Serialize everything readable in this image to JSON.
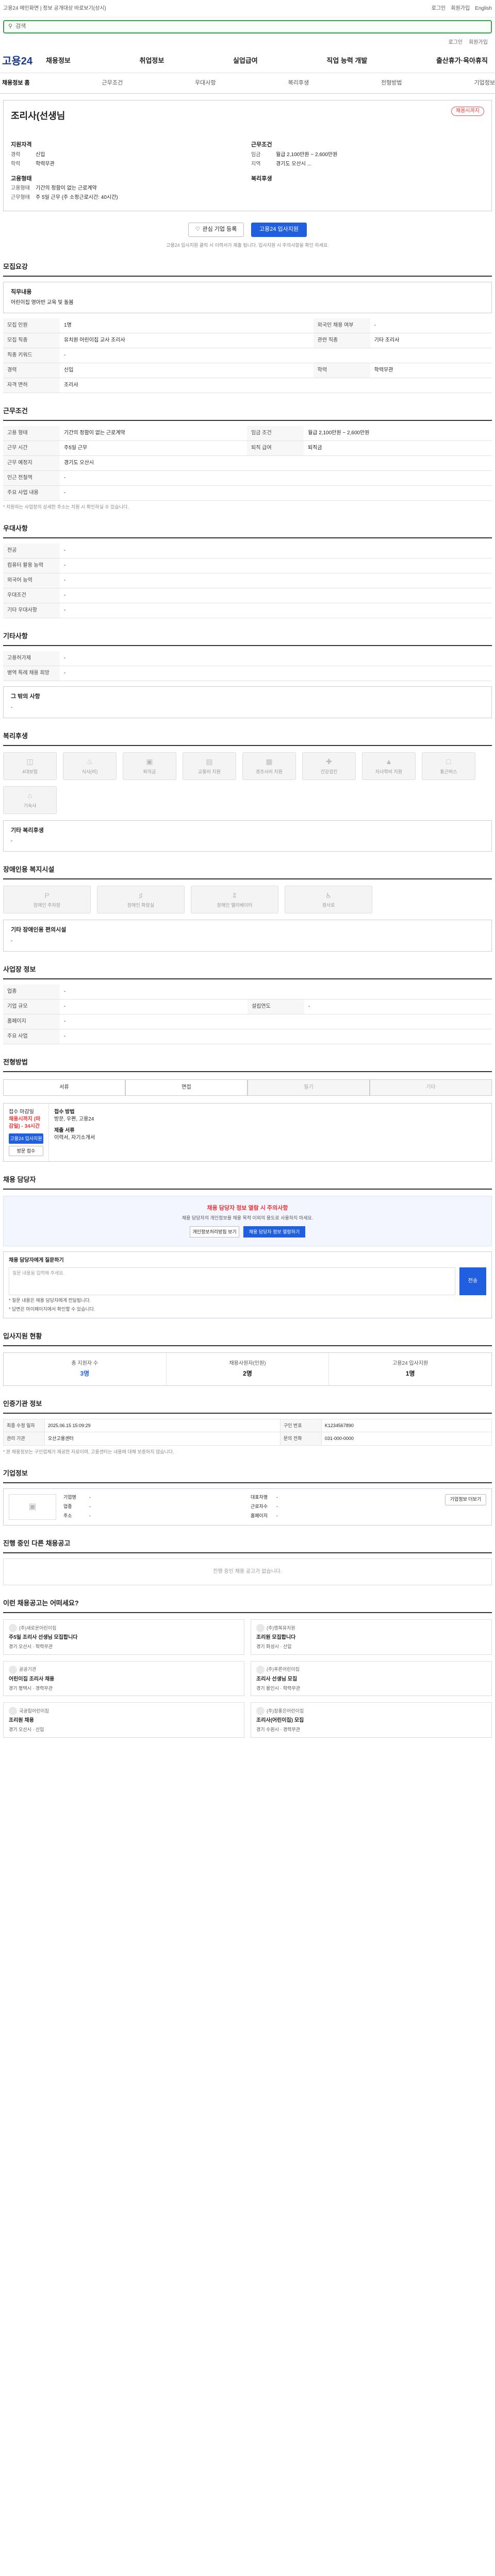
{
  "topbar": {
    "left": "고용24 메인화면 | 정보 공개대상 바로보기(상시)",
    "right": [
      "로그인",
      "회원가입",
      "English"
    ]
  },
  "search": {
    "placeholder": "검색"
  },
  "util": [
    "로그인",
    "회원가입"
  ],
  "gnb": {
    "logo": "고용24",
    "menu": [
      "채용정보",
      "취업정보",
      "실업급여",
      "직업 능력 개발",
      "출산휴가·육아휴직"
    ]
  },
  "lnb": {
    "items": [
      "채용정보 홈",
      "근무조건",
      "우대사항",
      "복리후생",
      "전형방법",
      "기업정보"
    ]
  },
  "job": {
    "company_name": "",
    "title": "조리사(선생님",
    "close_badge": "채용시까지",
    "col1_head": "지원자격",
    "career": "신입",
    "education": "학력무관",
    "col2_head": "근무조건",
    "salary_label": "임금",
    "salary": "월급 2,100만원 ~ 2,600만원",
    "location_label": "지역",
    "location": "경기도 오산시 ...",
    "work_type_head": "고용형태",
    "work_type_label": "고용형태",
    "work_type": "기간의 정함이 없는 근로계약",
    "work_time_label": "근무형태",
    "work_time": "주 5일 근무 (주 소정근로시간: 40시간)",
    "welfare_head": "복리후생",
    "welfare": ""
  },
  "actions": {
    "interest": "관심 기업 등록",
    "apply": "고용24 입사지원"
  },
  "action_note": "고용24 입사지원 클릭 시 이력서가 제출 됩니다. 입사지원 시 주의사항을 확인 하세요.",
  "summary": {
    "title": "모집요강",
    "duty_head": "직무내용",
    "duty": "어린이집 영아반 교육 및 돌봄"
  },
  "recruit": {
    "rows": [
      [
        "모집 인원",
        "1명",
        "외국인 채용 여부",
        "-"
      ],
      [
        "모집 직종",
        "유치원 어린이집 교사 조리사",
        "관련 직종",
        "기타 조리사"
      ],
      [
        "직종 키워드",
        "-",
        "",
        ""
      ],
      [
        "경력",
        "신입",
        "학력",
        "학력무관"
      ],
      [
        "자격 면허",
        "조리사",
        "",
        ""
      ]
    ]
  },
  "cond": {
    "title": "근무조건",
    "rows": [
      [
        "고용 형태",
        "기간의 정함이 없는 근로계약",
        "임금 조건",
        "월급 2,100만원 ~ 2,600만원"
      ],
      [
        "근무 시간",
        "주5일 근무",
        "퇴직 급여",
        "퇴직금"
      ],
      [
        "근무 예정지",
        "경기도 오산시",
        "",
        ""
      ],
      [
        "인근 전철역",
        "-",
        "",
        ""
      ],
      [
        "주요 사업 내용",
        "-",
        "",
        ""
      ]
    ],
    "note": "* 지원하는 사업장의 상세한 주소는 지원 시 확인하실 수 있습니다."
  },
  "prefer": {
    "title": "우대사항",
    "rows": [
      [
        "전공",
        "-"
      ],
      [
        "컴퓨터 활용 능력",
        "-"
      ],
      [
        "외국어 능력",
        "-"
      ],
      [
        "우대조건",
        "-"
      ],
      [
        "기타 우대사항",
        "-"
      ]
    ]
  },
  "etc": {
    "title": "기타사항",
    "rows": [
      [
        "고용허가제",
        "-"
      ],
      [
        "병역 특례 채용 희망",
        "-"
      ]
    ],
    "misc_head": "그 밖의 사항",
    "misc": "-"
  },
  "welfare": {
    "title": "복리후생",
    "cards": [
      "4대보험",
      "식사(비)",
      "퇴직금",
      "교통비 지원",
      "경조사비 지원",
      "건강검진",
      "자녀학비 지원",
      "통근버스",
      "기숙사"
    ],
    "misc_head": "기타 복리후생",
    "misc": "-"
  },
  "disabled": {
    "title": "장애인용 복지시설",
    "cards": [
      "장애인 주차장",
      "장애인 화장실",
      "장애인 엘리베이터",
      "경사로"
    ],
    "misc_head": "기타 장애인용 편의시설",
    "misc": "-"
  },
  "company": {
    "title": "사업장 정보",
    "rows": [
      [
        "업종",
        "-",
        "",
        ""
      ],
      [
        "기업 규모",
        "-",
        "설립연도",
        "-"
      ],
      [
        "홈페이지",
        "-",
        "",
        ""
      ],
      [
        "주요 사업",
        "-",
        "",
        ""
      ]
    ]
  },
  "process": {
    "title": "전형방법",
    "steps": [
      "서류",
      "면접",
      "필기",
      "기타"
    ],
    "apply_head": "접수 마감일",
    "apply_date": "채용시까지 (마감일) - 34시간",
    "apply_btn": "고용24 입사지원",
    "apply_btn2": "방문 접수",
    "method_head": "접수 방법",
    "method": "방문, 우편, 고용24",
    "doc_head": "제출 서류",
    "doc": "이력서, 자기소개서"
  },
  "contact": {
    "title": "채용 담당자",
    "alert_title": "채용 담당자 정보 열람 시 주의사항",
    "alert_desc": "채용 담당자의 개인정보를 채용 목적 이외의 용도로 사용하지 마세요.",
    "btn1": "개인정보처리방침 보기",
    "btn2": "채용 담당자 정보 열람하기"
  },
  "qna": {
    "title": "채용 담당자에게 질문하기",
    "placeholder": "질문 내용을 입력해 주세요.",
    "btn": "전송",
    "bullets": [
      "* 질문 내용은 채용 담당자에게 전달됩니다.",
      "* 답변은 마이페이지에서 확인할 수 있습니다."
    ]
  },
  "stats": {
    "title": "입사지원 현황",
    "items": [
      {
        "label": "총 지원자 수",
        "value": "3명"
      },
      {
        "label": "채용사원자(인원)",
        "value": "2명"
      },
      {
        "label": "고용24 입사지원",
        "value": "1명"
      }
    ]
  },
  "info": {
    "title": "인증기관 정보",
    "rows": [
      [
        "최종 수정 일자",
        "2025.06.15 15:09:29",
        "구인 번호",
        "K1234567890"
      ],
      [
        "관리 기관",
        "오산고용센터",
        "문의 전화",
        "031-000-0000"
      ]
    ],
    "note": "* 본 채용정보는 구인업체가 제공한 자료이며, 고용센터는 내용에 대해 보증하지 않습니다."
  },
  "corp": {
    "title": "기업정보",
    "more": "기업정보 더보기",
    "fields": [
      [
        "기업명",
        "-"
      ],
      [
        "대표자명",
        "-"
      ],
      [
        "업종",
        "-"
      ],
      [
        "근로자수",
        "-"
      ],
      [
        "주소",
        "-"
      ],
      [
        "홈페이지",
        "-"
      ]
    ]
  },
  "others": {
    "title": "진행 중인 다른 채용공고",
    "empty": "진행 중인 채용 공고가 없습니다."
  },
  "recos": {
    "title": "이런 채용공고는 어떠세요?",
    "items": [
      {
        "company": "(주)새로운어린이집",
        "title": "주5일 조리사 선생님 모집합니다",
        "meta": "경기 오산시 · 학력무관"
      },
      {
        "company": "(주)행복유치원",
        "title": "조리원 모집합니다",
        "meta": "경기 화성시 · 신입"
      },
      {
        "company": "공공기관",
        "title": "어린이집 조리사 채용",
        "meta": "경기 평택시 · 경력무관"
      },
      {
        "company": "(주)푸른어린이집",
        "title": "조리사 선생님 모집",
        "meta": "경기 용인시 · 학력무관"
      },
      {
        "company": "국공립어린이집",
        "title": "조리원 채용",
        "meta": "경기 오산시 · 신입"
      },
      {
        "company": "(주)참좋은어린이집",
        "title": "조리사(어린이집) 모집",
        "meta": "경기 수원시 · 경력무관"
      }
    ]
  },
  "colors": {
    "accent": "#1f5fe0",
    "brand": "#1a3b8c",
    "danger": "#e33333",
    "search_border": "#2ea84a"
  }
}
